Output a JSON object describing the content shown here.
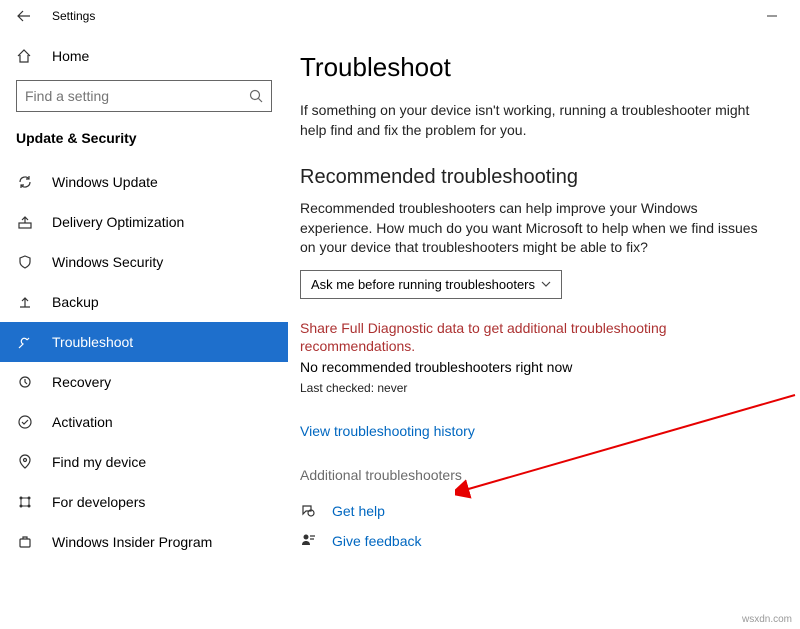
{
  "titlebar": {
    "title": "Settings"
  },
  "sidebar": {
    "home_label": "Home",
    "search_placeholder": "Find a setting",
    "section": "Update & Security",
    "items": [
      {
        "label": "Windows Update"
      },
      {
        "label": "Delivery Optimization"
      },
      {
        "label": "Windows Security"
      },
      {
        "label": "Backup"
      },
      {
        "label": "Troubleshoot"
      },
      {
        "label": "Recovery"
      },
      {
        "label": "Activation"
      },
      {
        "label": "Find my device"
      },
      {
        "label": "For developers"
      },
      {
        "label": "Windows Insider Program"
      }
    ]
  },
  "main": {
    "title": "Troubleshoot",
    "intro": "If something on your device isn't working, running a troubleshooter might help find and fix the problem for you.",
    "rec_title": "Recommended troubleshooting",
    "rec_body": "Recommended troubleshooters can help improve your Windows experience. How much do you want Microsoft to help when we find issues on your device that troubleshooters might be able to fix?",
    "dropdown_value": "Ask me before running troubleshooters",
    "warn": "Share Full Diagnostic data to get additional troubleshooting recommendations.",
    "status": "No recommended troubleshooters right now",
    "last_checked": "Last checked: never",
    "history_link": "View troubleshooting history",
    "additional": "Additional troubleshooters",
    "help": "Get help",
    "feedback": "Give feedback"
  },
  "watermark": "wsxdn.com"
}
